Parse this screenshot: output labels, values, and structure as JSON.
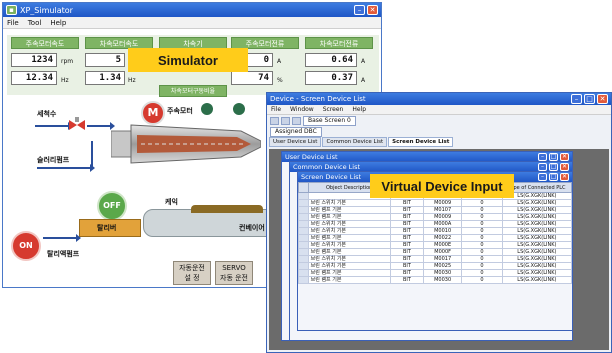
{
  "simulator": {
    "title": "XP_Simulator",
    "menu": [
      "File",
      "Tool",
      "Help"
    ],
    "gauges": [
      {
        "label": "주속모터속도",
        "value1": "1234",
        "unit1": "rpm",
        "value2": "12.34",
        "unit2": "Hz"
      },
      {
        "label": "차속모터속도",
        "value1": "5",
        "unit1": "",
        "value2": "1.34",
        "unit2": "Hz"
      },
      {
        "label": "차속기",
        "value1": "",
        "unit1": "",
        "value2": "차속모터구동비율",
        "unit2": ""
      },
      {
        "label": "주속모터전류",
        "value1": "0",
        "unit1": "A",
        "value2": "74",
        "unit2": "%"
      },
      {
        "label": "차속모터전류",
        "value1": "0.64",
        "unit1": "A",
        "value2": "0.37",
        "unit2": "A"
      }
    ],
    "labels": {
      "feed_water": "세척수",
      "slurry_pump": "슬러리펌프",
      "main_motor": "주속모터",
      "cake": "케익",
      "conveyor": "컨베이어",
      "hopper": "탈리버",
      "slurry_pump2": "탈리액펌프",
      "motor_badge": "M",
      "off_badge": "OFF",
      "on_badge": "ON"
    },
    "buttons": [
      {
        "line1": "자동운전",
        "line2": "설 정"
      },
      {
        "line1": "SERVO",
        "line2": "자동 운전"
      }
    ]
  },
  "callouts": {
    "simulator": "Simulator",
    "virtual": "Virtual Device Input"
  },
  "device": {
    "title": "Device - Screen Device List",
    "menu": [
      "File",
      "Window",
      "Screen",
      "Help"
    ],
    "combo_screen": "Base Screen 0",
    "combo_plc": "Assigned DBC",
    "tabs": [
      "User Device List",
      "Common Device List",
      "Screen Device List"
    ],
    "sub_user": "User Device List",
    "sub_common": "Common Device List",
    "sub_screen": "Screen Device List",
    "columns": [
      "Object Description",
      "",
      "",
      "",
      "Type of Connected PLC"
    ],
    "rows": [
      [
        "",
        "",
        "M0000",
        "",
        "LS(G.XGK(LINK)"
      ],
      [
        "브린 스위치 기본",
        "BIT",
        "M0009",
        "0",
        "LS(G.XGK(LINK)"
      ],
      [
        "브린 램프 기본",
        "BIT",
        "M0107",
        "0",
        "LS(G.XGK(LINK)"
      ],
      [
        "브린 램프 기본",
        "BIT",
        "M0009",
        "0",
        "LS(G.XGK(LINK)"
      ],
      [
        "브린 스위치 기본",
        "BIT",
        "M000A",
        "0",
        "LS(G.XGK(LINK)"
      ],
      [
        "브린 스위치 기본",
        "BIT",
        "M0010",
        "0",
        "LS(G.XGK(LINK)"
      ],
      [
        "브린 램프 기본",
        "BIT",
        "M0022",
        "0",
        "LS(G.XGK(LINK)"
      ],
      [
        "브린 스위치 기본",
        "BIT",
        "M000E",
        "0",
        "LS(G.XGK(LINK)"
      ],
      [
        "브린 램프 기본",
        "BIT",
        "M000F",
        "0",
        "LS(G.XGK(LINK)"
      ],
      [
        "브린 스위치 기본",
        "BIT",
        "M0017",
        "0",
        "LS(G.XGK(LINK)"
      ],
      [
        "브린 스위치 기본",
        "BIT",
        "M0025",
        "0",
        "LS(G.XGK(LINK)"
      ],
      [
        "브린 램프 기본",
        "BIT",
        "M0030",
        "0",
        "LS(G.XGK(LINK)"
      ],
      [
        "브린 램프 기본",
        "BIT",
        "M0030",
        "0",
        "LS(G.XGK(LINK)"
      ]
    ]
  },
  "colors": {
    "gauge_header": "#7fb464",
    "callout": "#ffcc1a",
    "titlebar": "#1f56c6",
    "motor_red": "#d63a2f",
    "off_green": "#5aa84a",
    "on_red": "#d63a2f"
  }
}
